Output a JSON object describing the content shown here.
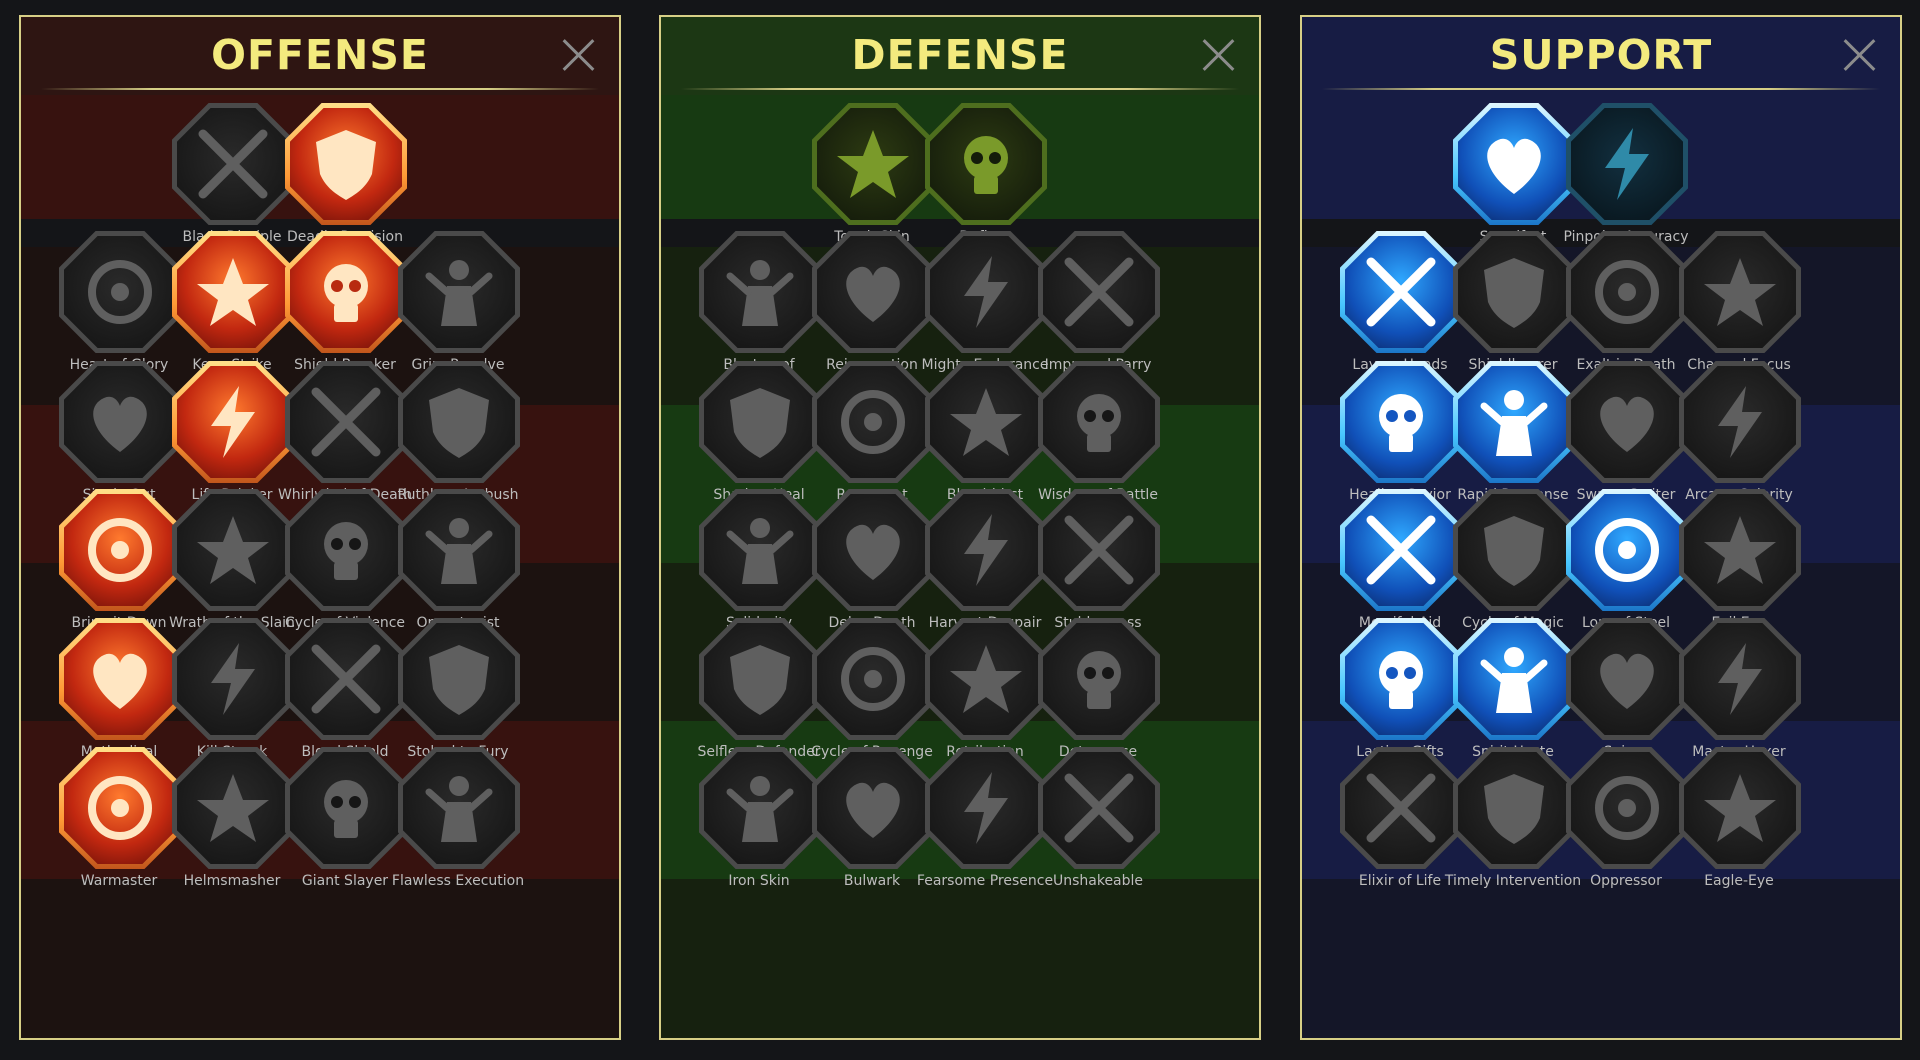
{
  "panels": [
    {
      "title": "OFFENSE",
      "skills": [
        {
          "label": "Blade Disciple",
          "icon": "crossed-swords-icon",
          "state": "inactive"
        },
        {
          "label": "Deadly Precision",
          "icon": "dagger-burst-icon",
          "state": "red"
        },
        {
          "label": "Heart of Glory",
          "icon": "heart-figure-icon",
          "state": "inactive"
        },
        {
          "label": "Keen Strike",
          "icon": "sword-burst-icon",
          "state": "red"
        },
        {
          "label": "Shield Breaker",
          "icon": "broken-shield-icon",
          "state": "red"
        },
        {
          "label": "Grim Resolve",
          "icon": "dark-heart-icon",
          "state": "inactive"
        },
        {
          "label": "Single Out",
          "icon": "arrow-target-icon",
          "state": "inactive"
        },
        {
          "label": "Life Drinker",
          "icon": "fangs-icon",
          "state": "red"
        },
        {
          "label": "Whirlwind of Death",
          "icon": "skull-whirl-icon",
          "state": "inactive"
        },
        {
          "label": "Ruthless Ambush",
          "icon": "dagger-hand-icon",
          "state": "inactive"
        },
        {
          "label": "Bring it Down",
          "icon": "pierced-heart-icon",
          "state": "red"
        },
        {
          "label": "Wrath of the Slain",
          "icon": "fist-blade-icon",
          "state": "inactive"
        },
        {
          "label": "Cycle of Violence",
          "icon": "axe-cycle-icon",
          "state": "inactive"
        },
        {
          "label": "Opportunist",
          "icon": "broken-chain-icon",
          "state": "inactive"
        },
        {
          "label": "Methodical",
          "icon": "arrows-target-icon",
          "state": "red"
        },
        {
          "label": "Kill Streak",
          "icon": "skulls-icon",
          "state": "inactive"
        },
        {
          "label": "Blood Shield",
          "icon": "sword-shield-icon",
          "state": "inactive"
        },
        {
          "label": "Stoked to Fury",
          "icon": "raging-figure-icon",
          "state": "inactive"
        },
        {
          "label": "Warmaster",
          "icon": "sword-fist-icon",
          "state": "red"
        },
        {
          "label": "Helmsmasher",
          "icon": "helmet-icon",
          "state": "inactive"
        },
        {
          "label": "Giant Slayer",
          "icon": "giant-icon",
          "state": "inactive"
        },
        {
          "label": "Flawless Execution",
          "icon": "spiked-skull-icon",
          "state": "inactive"
        }
      ]
    },
    {
      "title": "DEFENSE",
      "skills": [
        {
          "label": "Tough Skin",
          "icon": "scales-icon",
          "state": "green"
        },
        {
          "label": "Defiant",
          "icon": "raised-fist-icon",
          "state": "green"
        },
        {
          "label": "Blastproof",
          "icon": "shield-icon",
          "state": "inactive"
        },
        {
          "label": "Rejuvenation",
          "icon": "heart-hand-icon",
          "state": "inactive"
        },
        {
          "label": "Mighty Endurance",
          "icon": "strongman-icon",
          "state": "inactive"
        },
        {
          "label": "Improved Parry",
          "icon": "parry-blades-icon",
          "state": "inactive"
        },
        {
          "label": "Shadow Heal",
          "icon": "shadow-figure-icon",
          "state": "inactive"
        },
        {
          "label": "Resurgent",
          "icon": "knight-shield-icon",
          "state": "inactive"
        },
        {
          "label": "Bloodthirst",
          "icon": "skull-heart-icon",
          "state": "inactive"
        },
        {
          "label": "Wisdom of Battle",
          "icon": "hooded-head-icon",
          "state": "inactive"
        },
        {
          "label": "Solidarity",
          "icon": "group-icon",
          "state": "inactive"
        },
        {
          "label": "Delay Death",
          "icon": "hourglass-icon",
          "state": "inactive"
        },
        {
          "label": "Harvest Despair",
          "icon": "open-hand-icon",
          "state": "inactive"
        },
        {
          "label": "Stubborness",
          "icon": "bull-icon",
          "state": "inactive"
        },
        {
          "label": "Selfless Defender",
          "icon": "runner-shield-icon",
          "state": "inactive"
        },
        {
          "label": "Cycle of Revenge",
          "icon": "blood-drops-icon",
          "state": "inactive"
        },
        {
          "label": "Retribution",
          "icon": "skull-sun-icon",
          "state": "inactive"
        },
        {
          "label": "Deterrence",
          "icon": "hand-cycle-icon",
          "state": "inactive"
        },
        {
          "label": "Iron Skin",
          "icon": "armored-head-icon",
          "state": "inactive"
        },
        {
          "label": "Bulwark",
          "icon": "tower-shield-icon",
          "state": "inactive"
        },
        {
          "label": "Fearsome Presence",
          "icon": "bearded-skull-icon",
          "state": "inactive"
        },
        {
          "label": "Unshakeable",
          "icon": "flexing-figure-icon",
          "state": "inactive"
        }
      ]
    },
    {
      "title": "SUPPORT",
      "skills": [
        {
          "label": "Steadfast",
          "icon": "heart-plus-icon",
          "state": "blue"
        },
        {
          "label": "Pinpoint Accuracy",
          "icon": "swirl-target-icon",
          "state": "teal"
        },
        {
          "label": "Lay on Hands",
          "icon": "praying-hands-icon",
          "state": "blue"
        },
        {
          "label": "Shieldbearer",
          "icon": "radiant-shield-icon",
          "state": "inactive"
        },
        {
          "label": "Exalt in Death",
          "icon": "flaming-skull-icon",
          "state": "inactive"
        },
        {
          "label": "Charged Focus",
          "icon": "charged-hand-icon",
          "state": "inactive"
        },
        {
          "label": "Healing Savior",
          "icon": "healer-figure-icon",
          "state": "blue"
        },
        {
          "label": "Rapid Response",
          "icon": "lightning-cycle-icon",
          "state": "blue"
        },
        {
          "label": "Swarm Smiter",
          "icon": "cracked-bolt-icon",
          "state": "inactive"
        },
        {
          "label": "Arcane Celerity",
          "icon": "speed-figure-icon",
          "state": "inactive"
        },
        {
          "label": "Merciful Aid",
          "icon": "chained-heart-icon",
          "state": "blue"
        },
        {
          "label": "Cycle of Magic",
          "icon": "comet-cycle-icon",
          "state": "inactive"
        },
        {
          "label": "Lore of Steel",
          "icon": "open-book-icon",
          "state": "blue"
        },
        {
          "label": "Evil Eye",
          "icon": "glaring-eye-icon",
          "state": "inactive"
        },
        {
          "label": "Lasting Gifts",
          "icon": "compass-star-icon",
          "state": "blue"
        },
        {
          "label": "Spirit Haste",
          "icon": "winged-boot-icon",
          "state": "blue"
        },
        {
          "label": "Sniper",
          "icon": "eye-icon",
          "state": "inactive"
        },
        {
          "label": "Master Hexer",
          "icon": "voodoo-doll-icon",
          "state": "inactive"
        },
        {
          "label": "Elixir of Life",
          "icon": "potion-flask-icon",
          "state": "inactive"
        },
        {
          "label": "Timely Intervention",
          "icon": "vampire-skull-icon",
          "state": "inactive"
        },
        {
          "label": "Oppressor",
          "icon": "grasping-hand-icon",
          "state": "inactive"
        },
        {
          "label": "Eagle-Eye",
          "icon": "eagle-head-icon",
          "state": "inactive"
        }
      ]
    }
  ]
}
